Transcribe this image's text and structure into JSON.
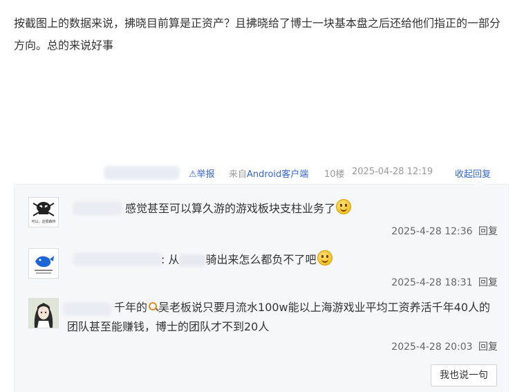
{
  "post": {
    "text": "按截图上的数据来说，拂晓目前算是正资产？且拂晓给了博士一块基本盘之后还给他们指正的一部分方向。总的来说好事"
  },
  "meta": {
    "report_label": "⚠举报",
    "client_prefix": "来自",
    "client_name": "Android客户端",
    "floor": "10楼",
    "timestamp": "2025-04-28 12:19",
    "collapse_label": "收起回复"
  },
  "replies": [
    {
      "avatar_caption": "可以，这很森林",
      "text": "感觉甚至可以算久游的游戏板块支柱业务了",
      "emoji": "smile-tongue",
      "time": "2025-4-28 12:36",
      "reply_label": "回复"
    },
    {
      "text_prefix": ": 从",
      "text_suffix": "骑出来怎么都负不了吧",
      "emoji": "smile",
      "time": "2025-4-28 18:31",
      "reply_label": "回复"
    },
    {
      "text_a": "千年的",
      "text_b": "吴老板说只要月流水100w能以上海游戏业平均工资养活千年40人的团队甚至能赚钱，博士的团队才不到20人",
      "time": "2025-4-28 20:03",
      "reply_label": "回复"
    }
  ],
  "say_button": "我也说一句",
  "colors": {
    "link": "#3366cc",
    "reply_bg": "#f6f7f9",
    "muted": "#999999"
  }
}
